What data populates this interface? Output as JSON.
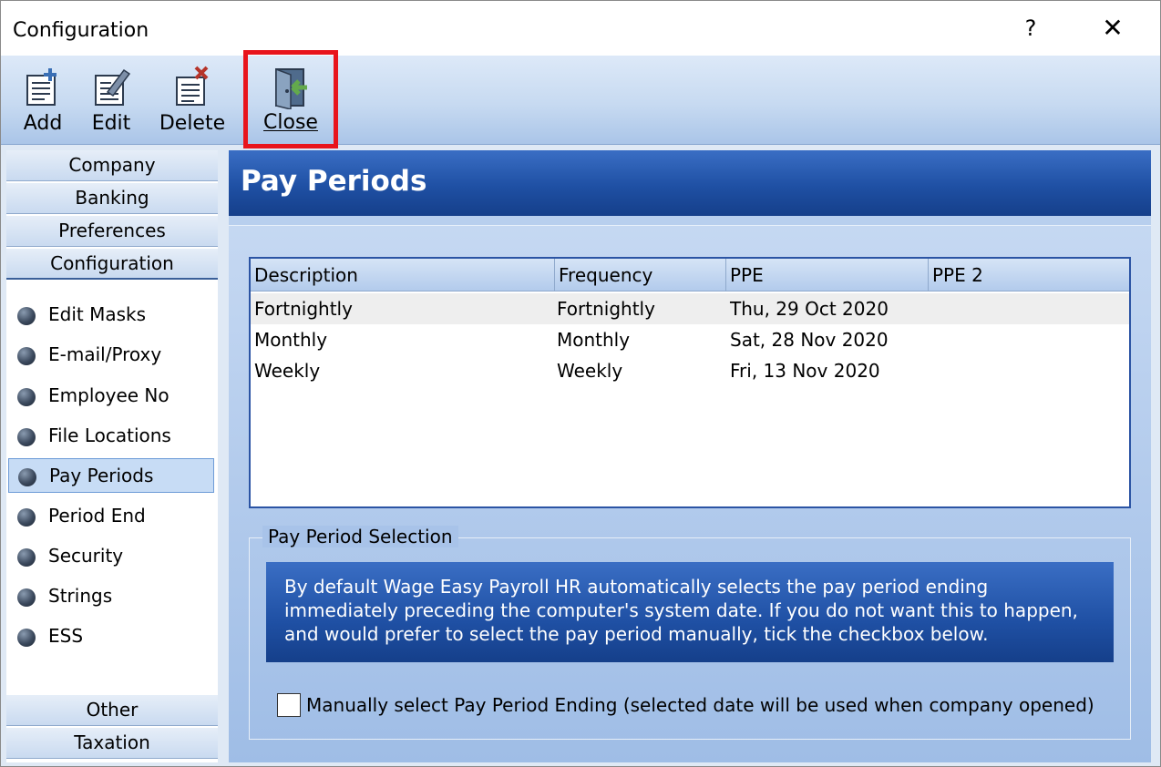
{
  "window": {
    "title": "Configuration",
    "help_glyph": "?",
    "close_glyph": "✕"
  },
  "toolbar": {
    "add_label": "Add",
    "edit_label": "Edit",
    "delete_label": "Delete",
    "close_label": "Close",
    "highlight_color": "#e8141c"
  },
  "nav": {
    "top_sections": [
      "Company",
      "Banking",
      "Preferences",
      "Configuration"
    ],
    "items": [
      "Edit Masks",
      "E-mail/Proxy",
      "Employee No",
      "File Locations",
      "Pay Periods",
      "Period End",
      "Security",
      "Strings",
      "ESS"
    ],
    "selected_item": "Pay Periods",
    "bottom_sections": [
      "Other",
      "Taxation"
    ]
  },
  "main": {
    "title": "Pay Periods",
    "grid": {
      "columns": [
        "Description",
        "Frequency",
        "PPE",
        "PPE 2"
      ],
      "rows": [
        [
          "Fortnightly",
          "Fortnightly",
          "Thu, 29 Oct 2020",
          ""
        ],
        [
          "Monthly",
          "Monthly",
          "Sat, 28 Nov 2020",
          ""
        ],
        [
          "Weekly",
          "Weekly",
          "Fri, 13 Nov 2020",
          ""
        ]
      ]
    },
    "selection_group": {
      "legend": "Pay Period Selection",
      "info_text": "By default Wage Easy Payroll HR automatically selects the pay period ending immediately preceding the computer's system date. If you do not want this to happen, and would prefer to select the pay period manually, tick the checkbox below.",
      "checkbox_label": "Manually select Pay Period Ending (selected date will be used when company opened)",
      "checkbox_checked": false
    }
  }
}
